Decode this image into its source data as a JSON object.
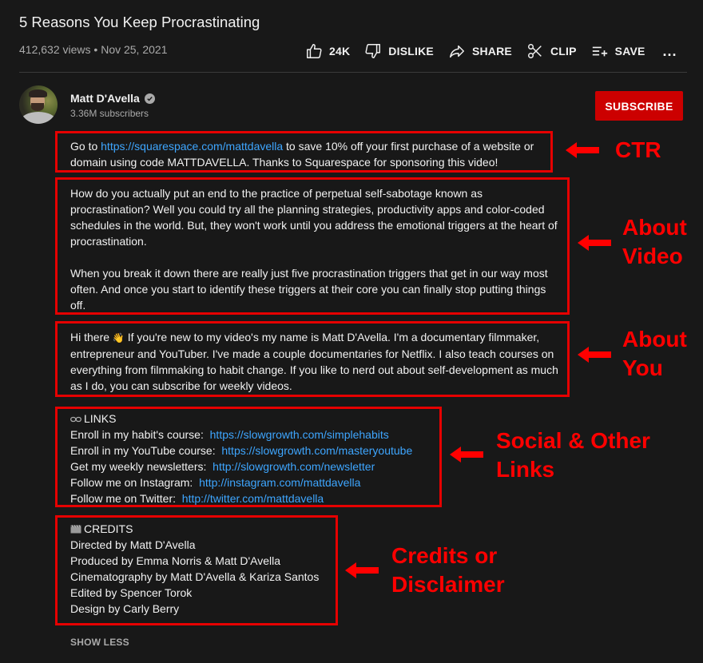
{
  "video": {
    "title": "5 Reasons You Keep Procrastinating",
    "views": "412,632 views",
    "separator": "•",
    "date": "Nov 25, 2021"
  },
  "actions": {
    "like_count": "24K",
    "dislike_label": "DISLIKE",
    "share_label": "SHARE",
    "clip_label": "CLIP",
    "save_label": "SAVE",
    "more_label": "..."
  },
  "channel": {
    "name": "Matt D'Avella",
    "verified": true,
    "subscribers": "3.36M subscribers",
    "subscribe_label": "SUBSCRIBE"
  },
  "description": {
    "ctr": {
      "prefix": "Go to ",
      "link": "https://squarespace.com/mattdavella",
      "suffix": " to save 10% off your first purchase of a website or domain using code MATTDAVELLA. Thanks to Squarespace for sponsoring this video!"
    },
    "about_video": {
      "paragraph1": "How do you actually put an end to the practice of perpetual self-sabotage known as procrastination? Well you could try all the planning strategies, productivity apps and color-coded schedules in the world. But, they won't work until you address the emotional triggers at the heart of procrastination.",
      "paragraph2": "When you break it down there are really just five procrastination triggers that get in our way most often. And once you start to identify these triggers at their core you can finally stop putting things off."
    },
    "about_you": {
      "greeting": "Hi there",
      "emoji": "👋",
      "text": " If you're new to my video's my name is Matt D'Avella. I'm a documentary filmmaker, entrepreneur and YouTuber. I've made a couple documentaries for Netflix. I also teach courses on everything from filmmaking to habit change. If you like to nerd out about self-development as much as I do, you can subscribe for weekly videos."
    },
    "links": {
      "heading": "LINKS",
      "items": [
        {
          "label": "Enroll in my habit's course:",
          "url": "https://slowgrowth.com/simplehabits"
        },
        {
          "label": "Enroll in my YouTube course:",
          "url": "https://slowgrowth.com/masteryoutube"
        },
        {
          "label": "Get my weekly newsletters:",
          "url": "http://slowgrowth.com/newsletter"
        },
        {
          "label": "Follow me on Instagram:",
          "url": "http://instagram.com/mattdavella"
        },
        {
          "label": "Follow me on Twitter:",
          "url": "http://twitter.com/mattdavella"
        }
      ]
    },
    "credits": {
      "heading": "CREDITS",
      "items": [
        "Directed by Matt D'Avella",
        "Produced by Emma Norris & Matt D'Avella",
        "Cinematography by Matt D'Avella & Kariza Santos",
        "Edited by Spencer Torok",
        "Design by Carly Berry"
      ]
    },
    "show_less_label": "SHOW LESS"
  },
  "annotations": {
    "color": "#ff0000",
    "ctr": "CTR",
    "about_video": [
      "About",
      "Video"
    ],
    "about_you": [
      "About",
      "You"
    ],
    "links": [
      "Social & Other",
      "Links"
    ],
    "credits": [
      "Credits or",
      "Disclaimer"
    ]
  }
}
